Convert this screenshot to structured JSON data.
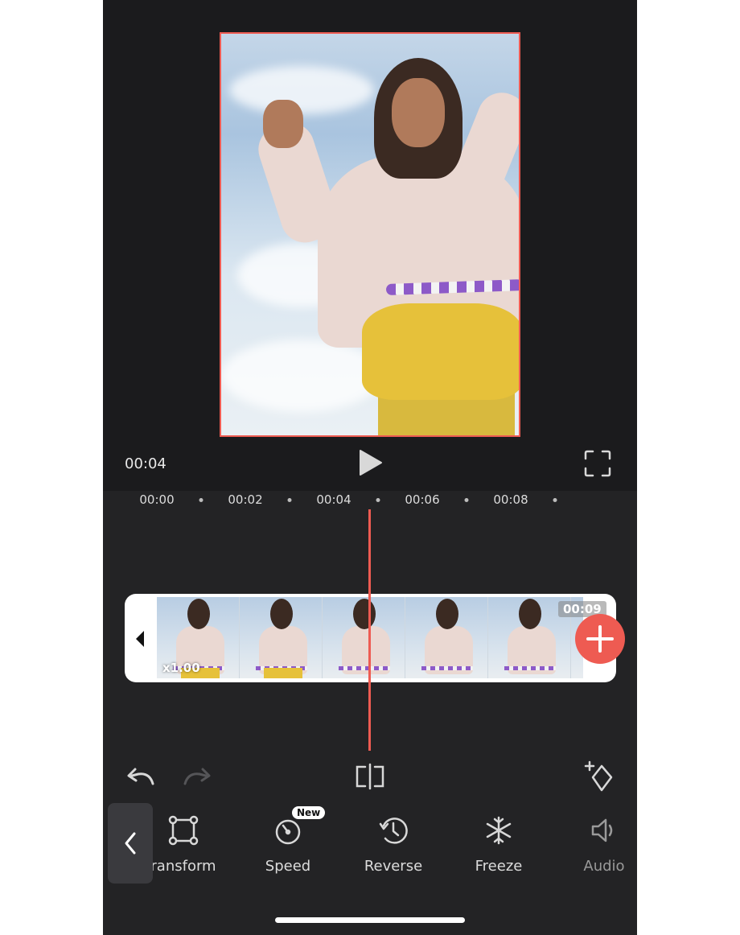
{
  "player": {
    "current_time": "00:04"
  },
  "ruler": {
    "ticks": [
      "00:00",
      "00:02",
      "00:04",
      "00:06",
      "00:08"
    ]
  },
  "clip": {
    "speed_label": "x1.00",
    "duration_label": "00:09"
  },
  "toolbar": {
    "items": [
      {
        "label": "ransform",
        "icon": "transform-icon"
      },
      {
        "label": "Speed",
        "icon": "speed-icon",
        "badge": "New"
      },
      {
        "label": "Reverse",
        "icon": "reverse-icon"
      },
      {
        "label": "Freeze",
        "icon": "freeze-icon"
      },
      {
        "label": "Audio",
        "icon": "audio-icon"
      }
    ]
  },
  "colors": {
    "accent": "#ee5b52",
    "background": "#1b1b1d",
    "timeline_bg": "#232325"
  }
}
